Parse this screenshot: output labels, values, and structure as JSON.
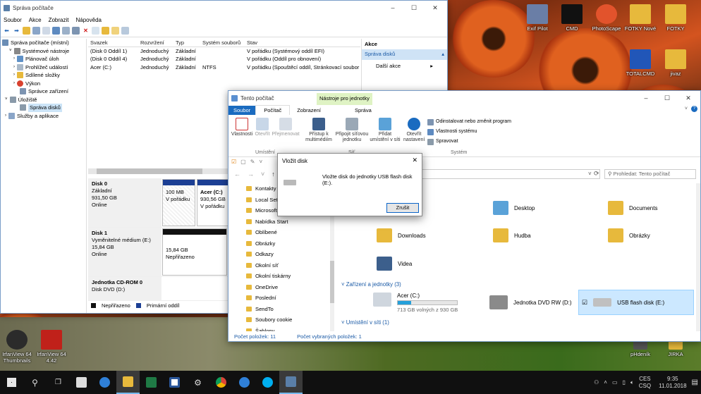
{
  "desktop": {
    "icons": [
      {
        "label": "Exif Pilot",
        "color": "#6a7ea6"
      },
      {
        "label": "CMD",
        "color": "#111111"
      },
      {
        "label": "PhotoScape",
        "color": "#e2532c"
      },
      {
        "label": "FOTKY Nové",
        "color": "#e7b93c"
      },
      {
        "label": "FOTKY",
        "color": "#e7b93c"
      },
      {
        "label": "TOTALCMD",
        "color": "#2156b8"
      },
      {
        "label": "jivaz",
        "color": "#e7b93c"
      },
      {
        "label": "IrfanView 64 Thumbnails",
        "color": "#2b2b2b"
      },
      {
        "label": "IrfanView 64 4.42",
        "color": "#c0211a"
      },
      {
        "label": "pHdeník",
        "color": "#555555"
      },
      {
        "label": "JIRKA",
        "color": "#e7b93c"
      }
    ]
  },
  "mmc": {
    "title": "Správa počítače",
    "menu": [
      "Soubor",
      "Akce",
      "Zobrazit",
      "Nápověda"
    ],
    "tree": [
      {
        "label": "Správa počítače (místní)",
        "indent": 0
      },
      {
        "label": "Systémové nástroje",
        "indent": 1
      },
      {
        "label": "Plánovač úloh",
        "indent": 2
      },
      {
        "label": "Prohlížeč událostí",
        "indent": 2
      },
      {
        "label": "Sdílené složky",
        "indent": 2
      },
      {
        "label": "Výkon",
        "indent": 2
      },
      {
        "label": "Správce zařízení",
        "indent": 2
      },
      {
        "label": "Úložiště",
        "indent": 1
      },
      {
        "label": "Správa disků",
        "indent": 2
      },
      {
        "label": "Služby a aplikace",
        "indent": 1
      }
    ],
    "columns": [
      "Svazek",
      "Rozvržení",
      "Typ",
      "Systém souborů",
      "Stav"
    ],
    "rows": [
      [
        "(Disk 0 Oddíl 1)",
        "Jednoduchý",
        "Základní",
        "",
        "V pořádku (Systémový oddíl EFI)"
      ],
      [
        "(Disk 0 Oddíl 4)",
        "Jednoduchý",
        "Základní",
        "",
        "V pořádku (Oddíl pro obnovení)"
      ],
      [
        "Acer (C:)",
        "Jednoduchý",
        "Základní",
        "NTFS",
        "V pořádku (Spouštěcí oddíl, Stránkovací soubor"
      ]
    ],
    "actions": {
      "header": "Akce",
      "section": "Správa disků",
      "item": "Další akce"
    },
    "disks": [
      {
        "name": "Disk 0",
        "lines": [
          "Základní",
          "931,50 GB",
          "Online"
        ],
        "parts": [
          {
            "l1": "100 MB",
            "l2": "V pořádku",
            "title": ""
          },
          {
            "title": "Acer (C:)",
            "l1": "930,56 GB",
            "l2": "V pořádku"
          }
        ]
      },
      {
        "name": "Disk 1",
        "lines": [
          "Vyměnitelné médium (E:)",
          "15,84 GB",
          "Online"
        ],
        "parts": [
          {
            "title": "",
            "l1": "15,84 GB",
            "l2": "Nepřiřazeno"
          }
        ]
      },
      {
        "name": "Jednotka CD-ROM 0",
        "lines": [
          "Disk DVD (D:)"
        ],
        "parts": []
      }
    ],
    "legend": [
      "Nepřiřazeno",
      "Primární oddíl"
    ]
  },
  "explorer": {
    "title": "Tento počítač",
    "context_tab": "Nástroje pro jednotky",
    "tabs": [
      "Soubor",
      "Počítač",
      "Zobrazení",
      "Správa"
    ],
    "ribbon": {
      "b1": "Vlastnosti",
      "b2": "Otevřít",
      "b3": "Přejmenovat",
      "b4": "Přístup k multimédiím",
      "b5": "Připojit síťovou jednotku",
      "b6": "Přidat umístění v síti",
      "b7": "Otevřít nastavení",
      "s1": "Odinstalovat nebo změnit program",
      "s2": "Vlastnosti systému",
      "s3": "Spravovat",
      "g1": "Umístění",
      "g2": "Síť",
      "g3": "Systém"
    },
    "search_placeholder": "Prohledat: Tento počítač",
    "nav": [
      "Kontakty",
      "Local Set",
      "Microsoft",
      "Nabídka Start",
      "Oblíbené",
      "Obrázky",
      "Odkazy",
      "Okolní síť",
      "Okolní tiskárny",
      "OneDrive",
      "Poslední",
      "SendTo",
      "Soubory cookie",
      "Šablony"
    ],
    "folders": [
      "Desktop",
      "Documents",
      "Downloads",
      "Hudba",
      "Obrázky",
      "Videa"
    ],
    "group_devices": "Zařízení a jednotky (3)",
    "group_net": "Umístění v síti (1)",
    "drives": {
      "c_name": "Acer (C:)",
      "c_free": "713 GB volných z 930 GB",
      "c_used_fraction": 0.23,
      "dvd": "Jednotka DVD RW (D:)",
      "usb": "USB flash disk (E:)"
    },
    "status": {
      "count": "Počet položek: 11",
      "selected": "Počet vybraných položek: 1"
    }
  },
  "dialog": {
    "title": "Vložit disk",
    "message": "Vložte disk do jednotky USB flash disk (E:).",
    "button": "Zrušit"
  },
  "taskbar": {
    "lang": "CES",
    "layout": "CSQ",
    "time": "9:35",
    "date": "11.01.2018"
  }
}
